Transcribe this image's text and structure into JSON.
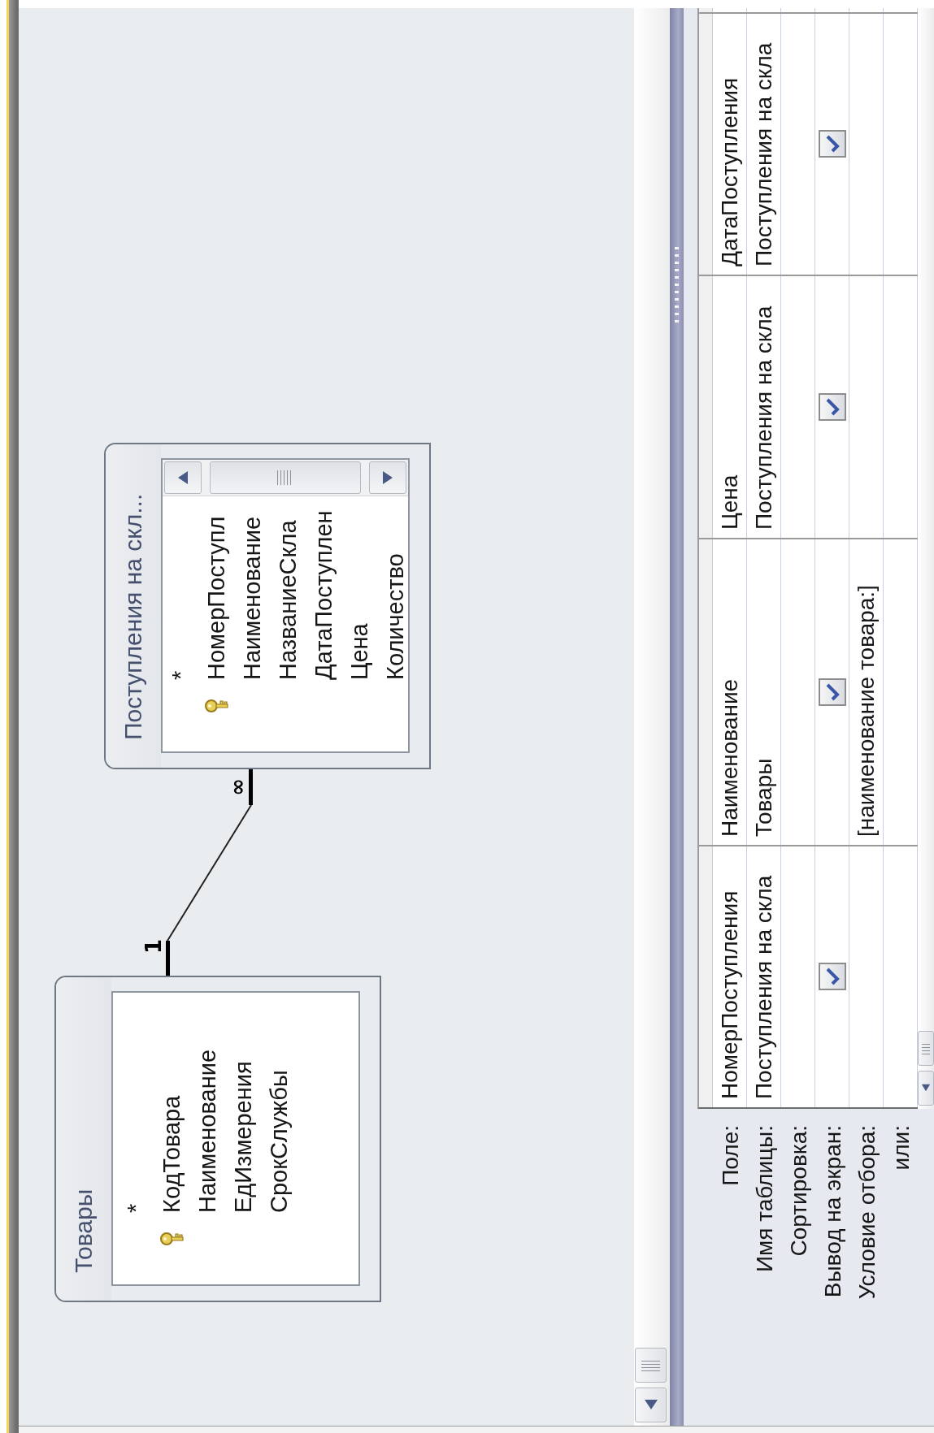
{
  "diagram": {
    "tables": [
      {
        "title": "Товары",
        "fields": [
          {
            "name": "*",
            "primary_key": false
          },
          {
            "name": "КодТовара",
            "primary_key": true
          },
          {
            "name": "Наименование",
            "primary_key": false
          },
          {
            "name": "ЕдИзмерения",
            "primary_key": false
          },
          {
            "name": "СрокСлужбы",
            "primary_key": false
          }
        ]
      },
      {
        "title": "Поступления на скл...",
        "fields": [
          {
            "name": "*",
            "primary_key": false
          },
          {
            "name": "НомерПоступл",
            "primary_key": true
          },
          {
            "name": "Наименование",
            "primary_key": false
          },
          {
            "name": "НазваниеСкла",
            "primary_key": false
          },
          {
            "name": "ДатаПоступлен",
            "primary_key": false
          },
          {
            "name": "Цена",
            "primary_key": false
          },
          {
            "name": "Количество",
            "primary_key": false
          }
        ]
      }
    ],
    "join": {
      "one_label": "1",
      "many_label": "∞"
    }
  },
  "grid": {
    "row_labels": [
      "Поле:",
      "Имя таблицы:",
      "Сортировка:",
      "Вывод на экран:",
      "Условие отбора:",
      "или:"
    ],
    "columns": [
      {
        "field": "НомерПоступления",
        "table": "Поступления на скла",
        "show": true
      },
      {
        "field": "Наименование",
        "table": "Товары",
        "show": true,
        "criteria": "[наименование товара:]"
      },
      {
        "field": "Цена",
        "table": "Поступления на скла",
        "show": true
      },
      {
        "field": "ДатаПоступления",
        "table": "Поступления на скла",
        "show": true
      }
    ]
  }
}
